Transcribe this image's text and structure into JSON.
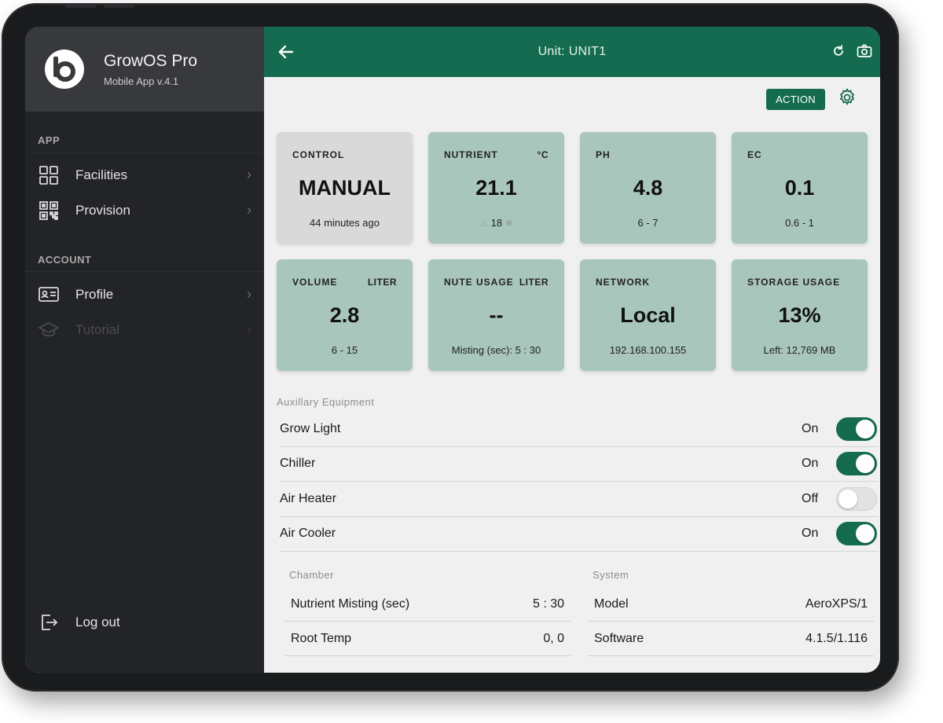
{
  "app": {
    "name": "GrowOS Pro",
    "version": "Mobile App v.4.1"
  },
  "sidebar": {
    "sections": [
      {
        "label": "APP",
        "items": [
          {
            "label": "Facilities",
            "icon": "grid-icon",
            "enabled": true
          },
          {
            "label": "Provision",
            "icon": "qr-code-icon",
            "enabled": true
          }
        ]
      },
      {
        "label": "ACCOUNT",
        "items": [
          {
            "label": "Profile",
            "icon": "id-card-icon",
            "enabled": true
          },
          {
            "label": "Tutorial",
            "icon": "graduation-cap-icon",
            "enabled": false
          }
        ]
      }
    ],
    "logout_label": "Log out"
  },
  "header": {
    "title": "Unit: UNIT1",
    "action_label": "ACTION"
  },
  "tiles": [
    {
      "title": "CONTROL",
      "unit": "",
      "value": "MANUAL",
      "sub": "44 minutes ago"
    },
    {
      "title": "NUTRIENT",
      "unit": "°C",
      "value": "21.1",
      "sub": "18"
    },
    {
      "title": "PH",
      "unit": "",
      "value": "4.8",
      "sub": "6 - 7"
    },
    {
      "title": "EC",
      "unit": "",
      "value": "0.1",
      "sub": "0.6 - 1"
    },
    {
      "title": "VOLUME",
      "unit": "LITER",
      "value": "2.8",
      "sub": "6 - 15"
    },
    {
      "title": "NUTE USAGE",
      "unit": "LITER",
      "value": "--",
      "sub": "Misting (sec): 5 : 30"
    },
    {
      "title": "NETWORK",
      "unit": "",
      "value": "Local",
      "sub": "192.168.100.155"
    },
    {
      "title": "STORAGE USAGE",
      "unit": "",
      "value": "13%",
      "sub": "Left: 12,769 MB"
    }
  ],
  "aux": {
    "label": "Auxillary Equipment",
    "items": [
      {
        "name": "Grow Light",
        "state": "On",
        "on": true
      },
      {
        "name": "Chiller",
        "state": "On",
        "on": true
      },
      {
        "name": "Air Heater",
        "state": "Off",
        "on": false
      },
      {
        "name": "Air Cooler",
        "state": "On",
        "on": true
      }
    ]
  },
  "chamber": {
    "label": "Chamber",
    "rows": [
      {
        "key": "Nutrient Misting (sec)",
        "value": "5 : 30"
      },
      {
        "key": "Root Temp",
        "value": "0, 0"
      }
    ]
  },
  "system": {
    "label": "System",
    "rows": [
      {
        "key": "Model",
        "value": "AeroXPS/1"
      },
      {
        "key": "Software",
        "value": "4.1.5/1.116"
      }
    ]
  },
  "colors": {
    "brand": "#146b50",
    "tile": "#a9c6bd",
    "tile_neutral": "#d9d9d9",
    "sidebar": "#232427"
  }
}
